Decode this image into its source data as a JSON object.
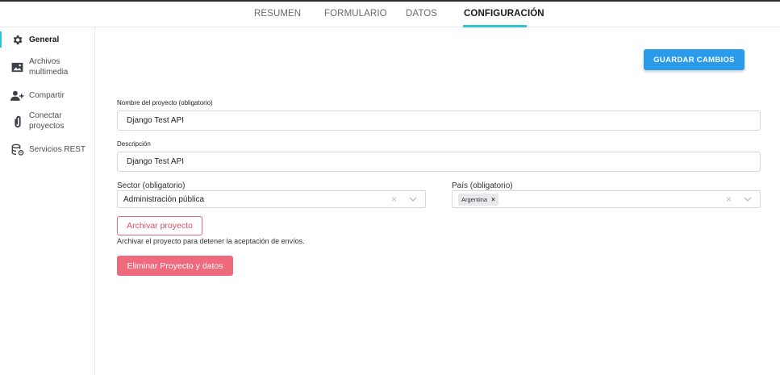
{
  "tabs": [
    {
      "label": "RESUMEN",
      "active": false
    },
    {
      "label": "FORMULARIO",
      "active": false
    },
    {
      "label": "DATOS",
      "active": false
    },
    {
      "label": "CONFIGURACIÓN",
      "active": true
    }
  ],
  "sidebar": {
    "items": [
      {
        "label": "General",
        "icon": "gear-icon",
        "active": true
      },
      {
        "label": "Archivos\nmultimedia",
        "icon": "image-icon",
        "active": false
      },
      {
        "label": "Compartir",
        "icon": "add-user-icon",
        "active": false
      },
      {
        "label": "Conectar\nproyectos",
        "icon": "paperclip-icon",
        "active": false
      },
      {
        "label": "Servicios REST",
        "icon": "database-gear-icon",
        "active": false
      }
    ]
  },
  "actions": {
    "save_label": "GUARDAR CAMBIOS"
  },
  "form": {
    "name": {
      "label": "Nombre del proyecto (obligatorio)",
      "value": "Django Test API"
    },
    "description": {
      "label": "Descripción",
      "value": "Django Test API"
    },
    "sector": {
      "label": "Sector (obligatorio)",
      "value": "Administración pública"
    },
    "country": {
      "label": "País (obligatorio)",
      "chips": [
        "Argentina"
      ]
    }
  },
  "archive": {
    "button_label": "Archivar proyecto",
    "help_text": "Archivar el proyecto para detener la aceptación de envíos."
  },
  "delete": {
    "button_label": "Eliminar Proyecto y datos"
  },
  "colors": {
    "accent": "#2ec3d6",
    "primary_button": "#2a9bea",
    "danger": "#f06a7d"
  }
}
